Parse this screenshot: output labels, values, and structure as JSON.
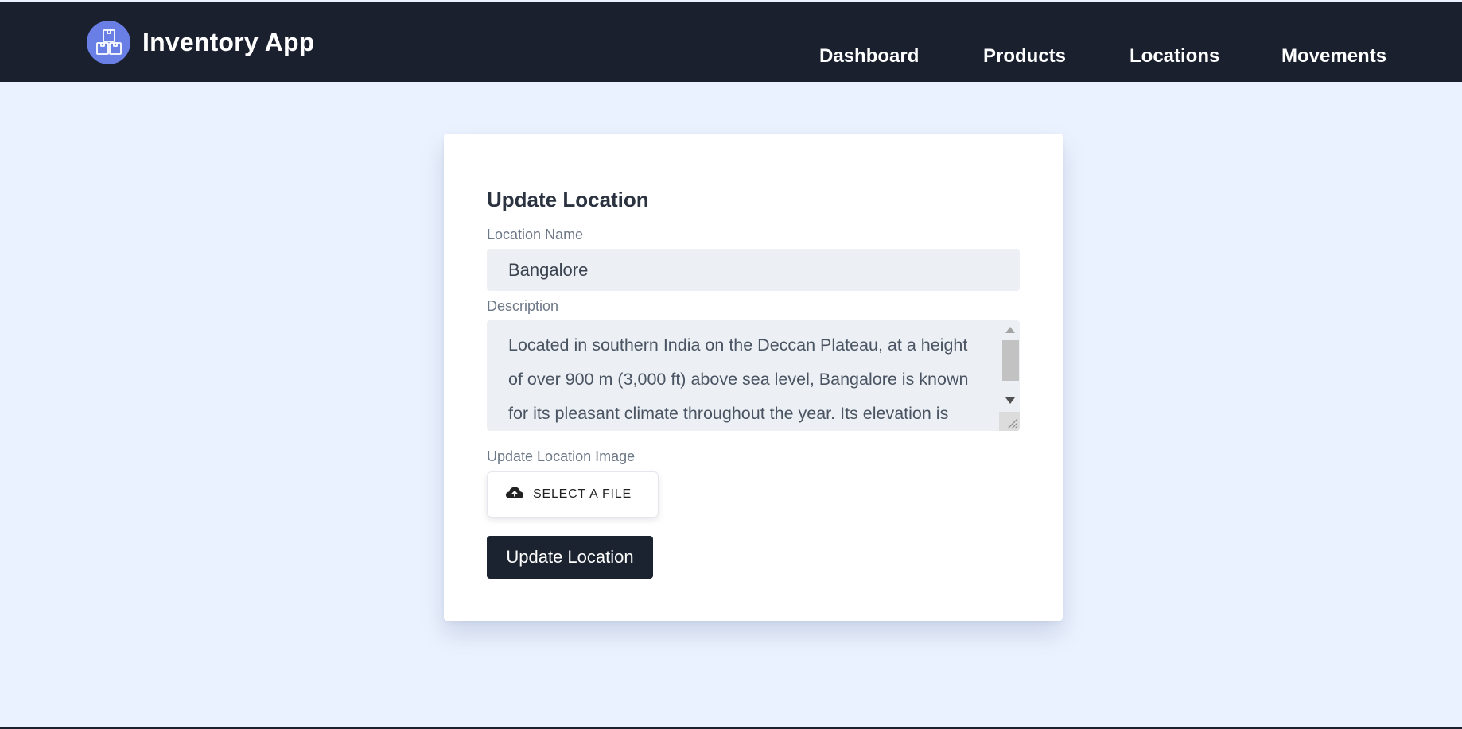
{
  "app": {
    "title": "Inventory App",
    "logo_icon": "boxes-icon",
    "logo_color": "#6a7fe6",
    "header_bg": "#1a202e"
  },
  "nav": {
    "items": [
      {
        "label": "Dashboard"
      },
      {
        "label": "Products"
      },
      {
        "label": "Locations"
      },
      {
        "label": "Movements"
      }
    ]
  },
  "form": {
    "title": "Update Location",
    "name_label": "Location Name",
    "name_value": "Bangalore",
    "description_label": "Description",
    "description_value": "Located in southern India on the Deccan Plateau, at a height of over 900 m (3,000 ft) above sea level, Bangalore is known for its pleasant climate throughout the year. Its elevation is",
    "image_label": "Update Location Image",
    "file_button_label": "SELECT A FILE",
    "file_button_icon": "cloud-upload-icon",
    "submit_label": "Update Location",
    "submit_color": "#1b2230"
  }
}
